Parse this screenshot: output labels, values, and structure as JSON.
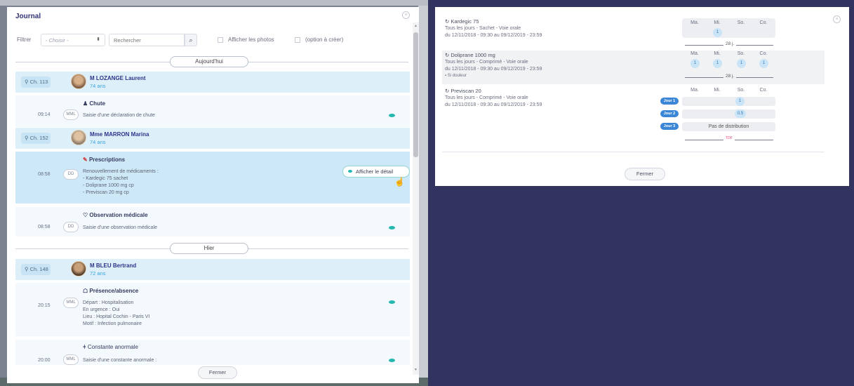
{
  "journal": {
    "title": "Journal",
    "filter": {
      "label": "Filtrer",
      "select_value": "- Choisir -",
      "search_placeholder": "Rechercher",
      "show_photos_label": "Afficher les photos",
      "option_label": "(option à créer)"
    },
    "sections": {
      "today": "Aujourd'hui",
      "yesterday": "Hier"
    },
    "patients": [
      {
        "room": "Ch. 113",
        "name": "M LOZANGE Laurent",
        "age": "74 ans"
      },
      {
        "room": "Ch. 152",
        "name": "Mme MARRON Marina",
        "age": "74 ans"
      },
      {
        "room": "Ch. 148",
        "name": "M BLEU Bertrand",
        "age": "72 ans"
      }
    ],
    "events": [
      {
        "time": "09:14",
        "badge": "MML",
        "title": "Chute",
        "lines": [
          "Saisie d'une déclaration de chute"
        ]
      },
      {
        "time": "08:58",
        "badge": "DD",
        "title": "Prescriptions",
        "lines": [
          "Renouvellement de médicaments :",
          "- Kardegic 75 sachet",
          "- Doliprane 1000 mg cp",
          "- Previscan 20 mg cp"
        ],
        "action": "Afficher le détail"
      },
      {
        "time": "08:58",
        "badge": "DD",
        "title": "Observation médicale",
        "lines": [
          "Saisie d'une observation médicale"
        ]
      },
      {
        "time": "20:15",
        "badge": "MML",
        "title": "Présence/absence",
        "lines": [
          "Départ : Hospitalisation",
          "En urgence : Oui",
          "Lieu : Hopital Cochin - Paris VI",
          "Motif : Infection pulmonaire"
        ]
      },
      {
        "time": "20:00",
        "badge": "MML",
        "title": "Constante anormale",
        "lines": [
          "Saisie d'une constante anormale :"
        ]
      }
    ],
    "close_label": "Fermer"
  },
  "prescription_detail": {
    "day_headers": [
      "Ma.",
      "Mi.",
      "So.",
      "Co."
    ],
    "meds": [
      {
        "name": "Kardegic 75",
        "schedule": "Tous les jours - Sachet - Voie orale",
        "dates": "du 12/11/2018 - 09:30   au 09/12/2019 - 23:59",
        "doses": [
          "1"
        ],
        "period": "28 j."
      },
      {
        "name": "Doliprane 1000 mg",
        "schedule": "Tous les jours - Comprimé - Voie orale",
        "dates": "du 12/11/2018 - 09:30   au 09/12/2019 - 23:59",
        "note": "Si douleur",
        "doses": [
          "1",
          "1",
          "1",
          "1"
        ],
        "period": "28 j."
      },
      {
        "name": "Previscan 20",
        "schedule": "Tous les jours - Comprimé - Voie orale",
        "dates": "du 12/11/2018 - 09:30   au 09/12/2019 - 23:59",
        "day_badges": [
          "Jour 1",
          "Jour 2",
          "Jour 3"
        ],
        "doses": [
          "1",
          "0.5"
        ],
        "no_distribution": "Pas de distribution",
        "period": "TDF"
      }
    ],
    "close_label": "Fermer"
  }
}
